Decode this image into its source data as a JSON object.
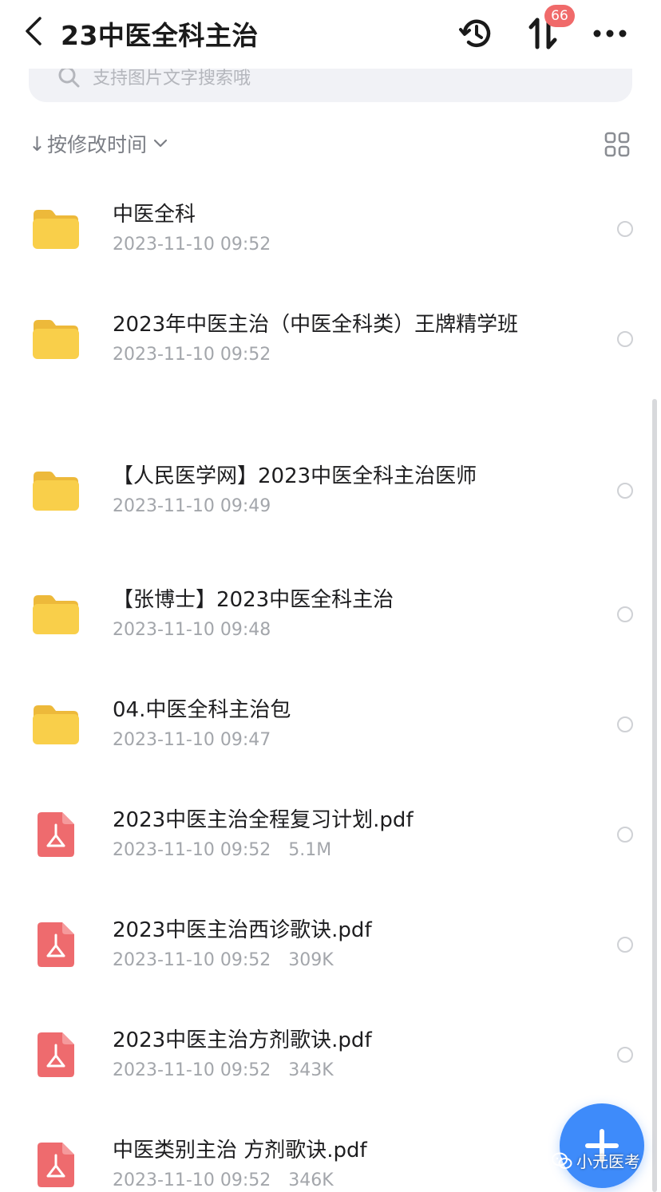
{
  "header": {
    "title": "23中医全科主治",
    "transfer_badge": "66"
  },
  "search": {
    "placeholder": "支持图片文字搜索哦"
  },
  "sort": {
    "arrow": "↓",
    "label": "按修改时间"
  },
  "files": [
    {
      "type": "folder",
      "name": "中医全科",
      "time": "2023-11-10 09:52",
      "size": ""
    },
    {
      "type": "folder",
      "name": "2023年中医主治（中医全科类）王牌精学班",
      "time": "2023-11-10 09:52",
      "size": ""
    },
    {
      "type": "folder",
      "name": "【人民医学网】2023中医全科主治医师",
      "time": "2023-11-10 09:49",
      "size": ""
    },
    {
      "type": "folder",
      "name": "【张博士】2023中医全科主治",
      "time": "2023-11-10 09:48",
      "size": ""
    },
    {
      "type": "folder",
      "name": "04.中医全科主治包",
      "time": "2023-11-10 09:47",
      "size": ""
    },
    {
      "type": "pdf",
      "name": "2023中医主治全程复习计划.pdf",
      "time": "2023-11-10 09:52",
      "size": "5.1M"
    },
    {
      "type": "pdf",
      "name": "2023中医主治西诊歌诀.pdf",
      "time": "2023-11-10 09:52",
      "size": "309K"
    },
    {
      "type": "pdf",
      "name": "2023中医主治方剂歌诀.pdf",
      "time": "2023-11-10 09:52",
      "size": "343K"
    },
    {
      "type": "pdf",
      "name": "中医类别主治 方剂歌诀.pdf",
      "time": "2023-11-10 09:52",
      "size": "346K"
    }
  ],
  "watermark": {
    "text": "小元医考"
  },
  "colors": {
    "folder": "#F9CF4A",
    "pdf": "#EE6B6E",
    "accent": "#3E8BFA",
    "badge": "#F06A6A"
  }
}
